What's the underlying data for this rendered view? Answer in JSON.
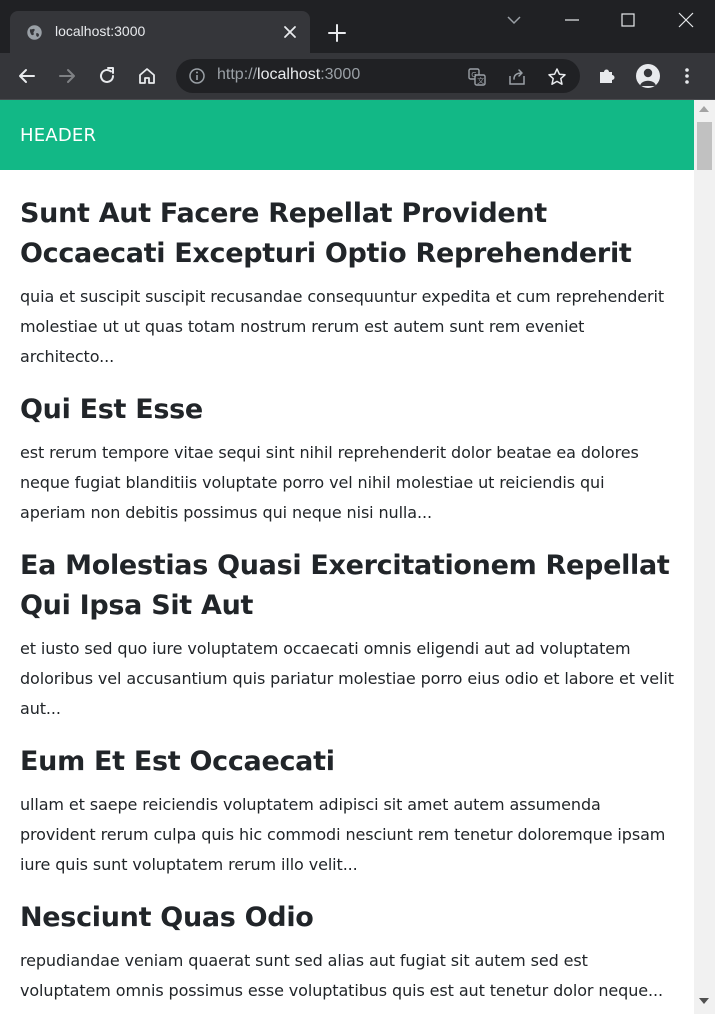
{
  "browser": {
    "tab_title": "localhost:3000",
    "url_scheme": "http://",
    "url_host": "localhost",
    "url_port": ":3000",
    "icons": {
      "favicon": "globe-icon",
      "tab_close": "close-icon",
      "new_tab": "plus-icon",
      "tab_search": "chevron-down-icon",
      "minimize": "minimize-icon",
      "maximize": "maximize-icon",
      "close_window": "close-icon",
      "back": "arrow-left-icon",
      "forward": "arrow-right-icon",
      "reload": "reload-icon",
      "home": "home-icon",
      "site_info": "info-icon",
      "translate": "translate-icon",
      "share": "share-icon",
      "bookmark": "star-icon",
      "extensions": "puzzle-icon",
      "profile": "avatar-icon",
      "menu": "kebab-menu-icon"
    }
  },
  "page": {
    "header_text": "HEADER",
    "header_color": "#12b886",
    "posts": [
      {
        "title": "Sunt Aut Facere Repellat Provident Occaecati Excepturi Optio Reprehenderit",
        "body": "quia et suscipit suscipit recusandae consequuntur expedita et cum reprehenderit molestiae ut ut quas totam nostrum rerum est autem sunt rem eveniet architecto..."
      },
      {
        "title": "Qui Est Esse",
        "body": "est rerum tempore vitae sequi sint nihil reprehenderit dolor beatae ea dolores neque fugiat blanditiis voluptate porro vel nihil molestiae ut reiciendis qui aperiam non debitis possimus qui neque nisi nulla..."
      },
      {
        "title": "Ea Molestias Quasi Exercitationem Repellat Qui Ipsa Sit Aut",
        "body": "et iusto sed quo iure voluptatem occaecati omnis eligendi aut ad voluptatem doloribus vel accusantium quis pariatur molestiae porro eius odio et labore et velit aut..."
      },
      {
        "title": "Eum Et Est Occaecati",
        "body": "ullam et saepe reiciendis voluptatem adipisci sit amet autem assumenda provident rerum culpa quis hic commodi nesciunt rem tenetur doloremque ipsam iure quis sunt voluptatem rerum illo velit..."
      },
      {
        "title": "Nesciunt Quas Odio",
        "body": "repudiandae veniam quaerat sunt sed alias aut fugiat sit autem sed est voluptatem omnis possimus esse voluptatibus quis est aut tenetur dolor neque..."
      }
    ]
  }
}
